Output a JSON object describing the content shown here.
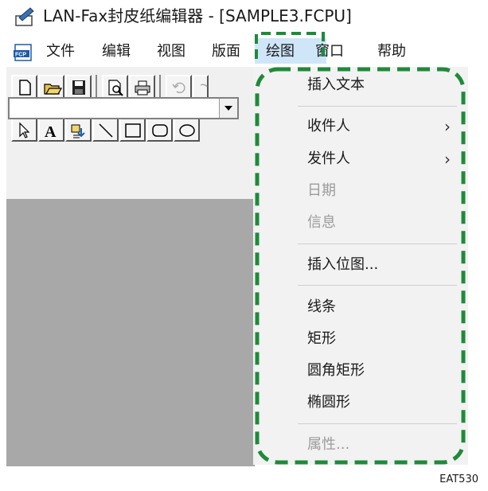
{
  "window": {
    "title": "LAN-Fax封皮纸编辑器 - [SAMPLE3.FCPU]"
  },
  "menubar": {
    "items": [
      {
        "id": "file",
        "label": "文件"
      },
      {
        "id": "edit",
        "label": "编辑"
      },
      {
        "id": "view",
        "label": "视图"
      },
      {
        "id": "layout",
        "label": "版面"
      },
      {
        "id": "draw",
        "label": "绘图",
        "active": true
      },
      {
        "id": "window",
        "label": "窗口"
      },
      {
        "id": "help",
        "label": "帮助"
      }
    ]
  },
  "toolbar": {
    "row1": [
      "new-document-icon",
      "open-folder-icon",
      "save-disk-icon",
      "print-preview-icon",
      "printer-icon",
      "undo-icon",
      "redo-icon"
    ],
    "row2": [
      "select-arrow-icon",
      "text-tool-icon",
      "field-insert-icon",
      "line-tool-icon",
      "rectangle-tool-icon",
      "rounded-rectangle-tool-icon",
      "ellipse-tool-icon"
    ]
  },
  "dropdown": {
    "items": [
      {
        "label": "插入文本",
        "enabled": true
      },
      {
        "label": "收件人",
        "enabled": true,
        "submenu": true
      },
      {
        "label": "发件人",
        "enabled": true,
        "submenu": true
      },
      {
        "label": "日期",
        "enabled": false
      },
      {
        "label": "信息",
        "enabled": false
      },
      {
        "label": "插入位图...",
        "enabled": true
      },
      {
        "label": "线条",
        "enabled": true
      },
      {
        "label": "矩形",
        "enabled": true
      },
      {
        "label": "圆角矩形",
        "enabled": true
      },
      {
        "label": "椭圆形",
        "enabled": true
      },
      {
        "label": "属性...",
        "enabled": false
      }
    ],
    "submenu_glyph": "›"
  },
  "figure_code": "EAT530",
  "colors": {
    "highlight": "#cfe6f9",
    "dashed_callout": "#1f8a3a",
    "canvas": "#a8a8a8"
  }
}
